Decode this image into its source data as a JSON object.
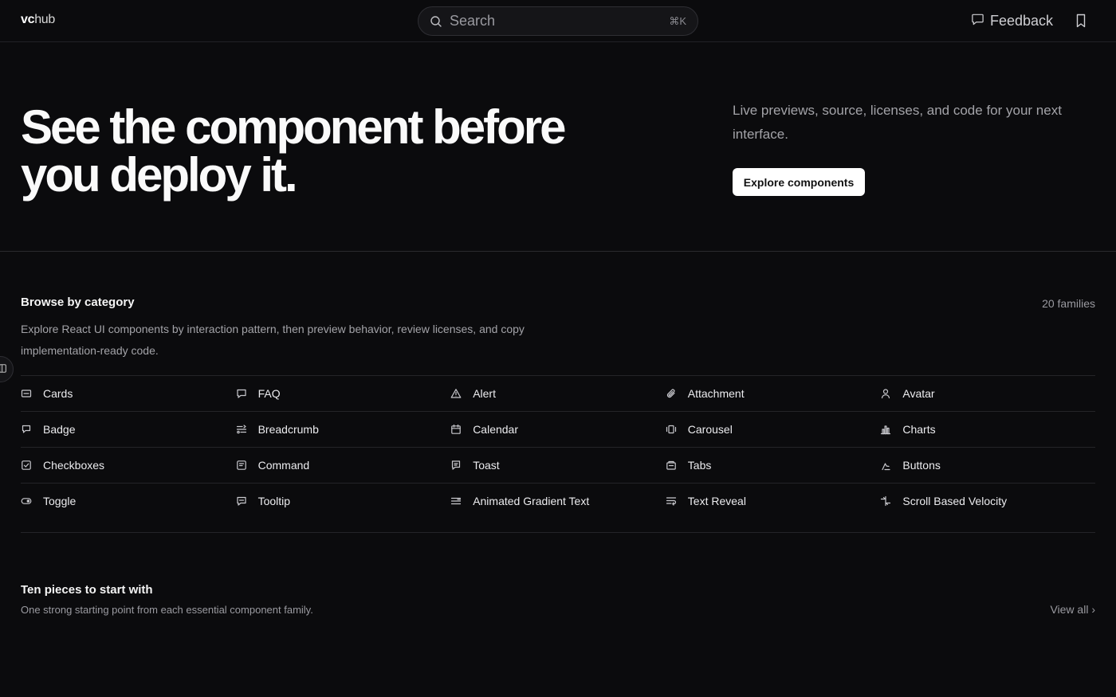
{
  "header": {
    "logo_a": "vc",
    "logo_b": "hub",
    "search_placeholder": "Search",
    "search_shortcut": "⌘K",
    "feedback_label": "Feedback"
  },
  "hero": {
    "headline": "See the component before you deploy it.",
    "lede": "Live previews, source, licenses, and code for your next interface.",
    "cta_label": "Explore components"
  },
  "browse": {
    "title": "Browse by category",
    "count": "20 families",
    "description": "Explore React UI components by interaction pattern, then preview behavior, review licenses, and copy implementation-ready code.",
    "categories": [
      {
        "label": "Cards",
        "icon": "card-icon"
      },
      {
        "label": "FAQ",
        "icon": "chat-icon"
      },
      {
        "label": "Alert",
        "icon": "warning-icon"
      },
      {
        "label": "Attachment",
        "icon": "paperclip-icon"
      },
      {
        "label": "Avatar",
        "icon": "user-icon"
      },
      {
        "label": "Badge",
        "icon": "badge-icon"
      },
      {
        "label": "Breadcrumb",
        "icon": "route-icon"
      },
      {
        "label": "Calendar",
        "icon": "calendar-icon"
      },
      {
        "label": "Carousel",
        "icon": "carousel-icon"
      },
      {
        "label": "Charts",
        "icon": "bar-chart-icon"
      },
      {
        "label": "Checkboxes",
        "icon": "checkbox-icon"
      },
      {
        "label": "Command",
        "icon": "command-icon"
      },
      {
        "label": "Toast",
        "icon": "message-icon"
      },
      {
        "label": "Tabs",
        "icon": "tabs-icon"
      },
      {
        "label": "Buttons",
        "icon": "pointer-icon"
      },
      {
        "label": "Toggle",
        "icon": "toggle-icon"
      },
      {
        "label": "Tooltip",
        "icon": "tooltip-icon"
      },
      {
        "label": "Animated Gradient Text",
        "icon": "text-lines-icon"
      },
      {
        "label": "Text Reveal",
        "icon": "text-wrap-icon"
      },
      {
        "label": "Scroll Based Velocity",
        "icon": "velocity-icon"
      }
    ]
  },
  "starter": {
    "title": "Ten pieces to start with",
    "subtitle": "One strong starting point from each essential component family.",
    "view_all": "View all ›"
  }
}
